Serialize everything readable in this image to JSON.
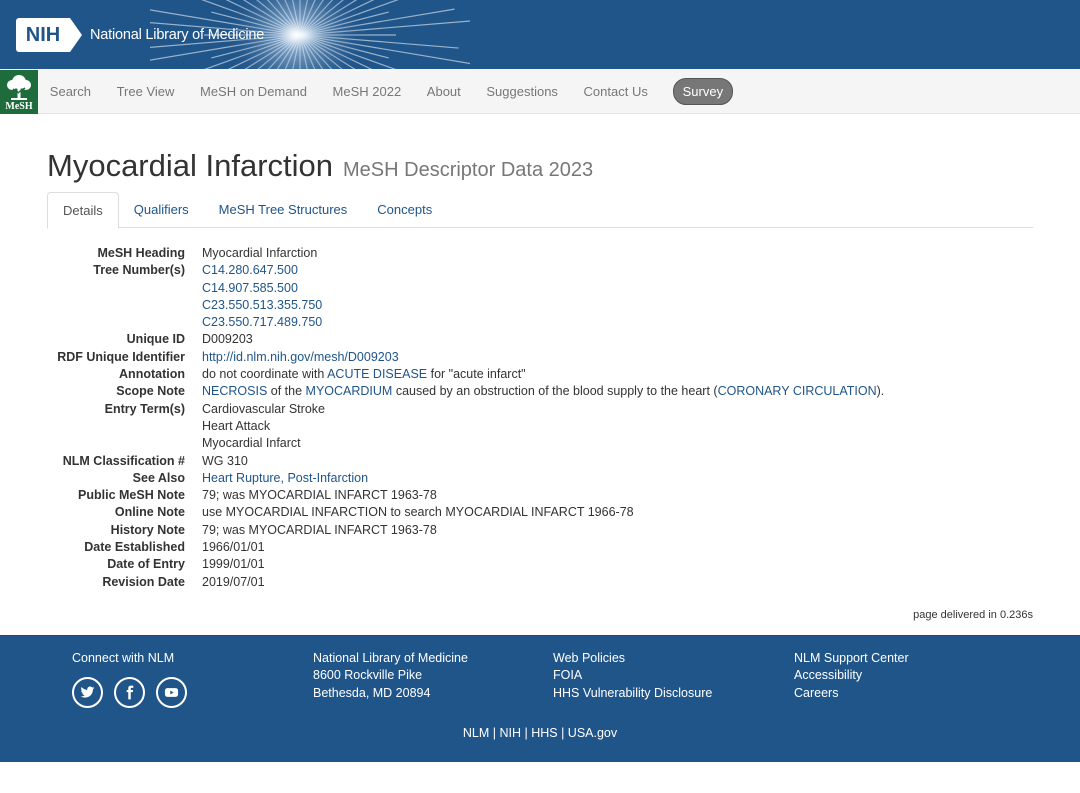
{
  "header": {
    "nih_badge": "NIH",
    "org_name": "National Library of Medicine"
  },
  "nav": {
    "logo_text": "MeSH",
    "items": [
      "Search",
      "Tree View",
      "MeSH on Demand",
      "MeSH 2022",
      "About",
      "Suggestions",
      "Contact Us"
    ],
    "survey": "Survey"
  },
  "page": {
    "title": "Myocardial Infarction",
    "subtitle": "MeSH Descriptor Data 2023"
  },
  "tabs": [
    "Details",
    "Qualifiers",
    "MeSH Tree Structures",
    "Concepts"
  ],
  "details": {
    "heading_label": "MeSH Heading",
    "heading": "Myocardial Infarction",
    "tree_label": "Tree Number(s)",
    "tree_numbers": [
      "C14.280.647.500",
      "C14.907.585.500",
      "C23.550.513.355.750",
      "C23.550.717.489.750"
    ],
    "uid_label": "Unique ID",
    "uid": "D009203",
    "rdf_label": "RDF Unique Identifier",
    "rdf": "http://id.nlm.nih.gov/mesh/D009203",
    "annotation_label": "Annotation",
    "annotation_pre": "do not coordinate with ",
    "annotation_link": "ACUTE DISEASE",
    "annotation_post": " for \"acute infarct\"",
    "scope_label": "Scope Note",
    "scope_link1": "NECROSIS",
    "scope_text1": " of the ",
    "scope_link2": "MYOCARDIUM",
    "scope_text2": " caused by an obstruction of the blood supply to the heart (",
    "scope_link3": "CORONARY CIRCULATION",
    "scope_text3": ").",
    "entry_label": "Entry Term(s)",
    "entry_terms": [
      "Cardiovascular Stroke",
      "Heart Attack",
      "Myocardial Infarct"
    ],
    "nlm_label": "NLM Classification #",
    "nlm": "WG 310",
    "see_also_label": "See Also",
    "see_also": "Heart Rupture, Post-Infarction",
    "public_label": "Public MeSH Note",
    "public": "79; was MYOCARDIAL INFARCT 1963-78",
    "online_label": "Online Note",
    "online": "use MYOCARDIAL INFARCTION to search MYOCARDIAL INFARCT 1966-78",
    "history_label": "History Note",
    "history": "79; was MYOCARDIAL INFARCT 1963-78",
    "established_label": "Date Established",
    "established": "1966/01/01",
    "entry_date_label": "Date of Entry",
    "entry_date": "1999/01/01",
    "revision_label": "Revision Date",
    "revision": "2019/07/01"
  },
  "delivered": "page delivered in 0.236s",
  "footer": {
    "connect": "Connect with NLM",
    "address": [
      "National Library of Medicine",
      "8600 Rockville Pike",
      "Bethesda, MD 20894"
    ],
    "policies": [
      "Web Policies",
      "FOIA",
      "HHS Vulnerability Disclosure"
    ],
    "support": [
      "NLM Support Center",
      "Accessibility",
      "Careers"
    ],
    "links": [
      "NLM",
      "NIH",
      "HHS",
      "USA.gov"
    ],
    "separator": " | "
  }
}
